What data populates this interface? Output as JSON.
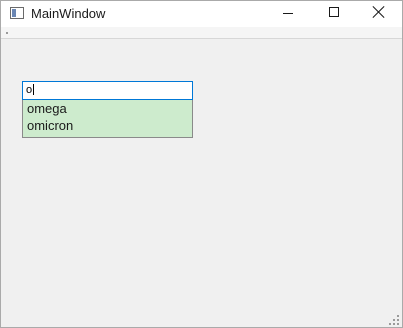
{
  "window": {
    "title": "MainWindow"
  },
  "titlebar_buttons": {
    "minimize": "minimize-icon",
    "maximize": "maximize-icon",
    "close": "close-icon"
  },
  "line_edit": {
    "value": "o"
  },
  "completer": {
    "items": [
      "omega",
      "omicron"
    ]
  },
  "colors": {
    "popup_bg": "#cdebcd",
    "focus_border": "#0078d7"
  }
}
